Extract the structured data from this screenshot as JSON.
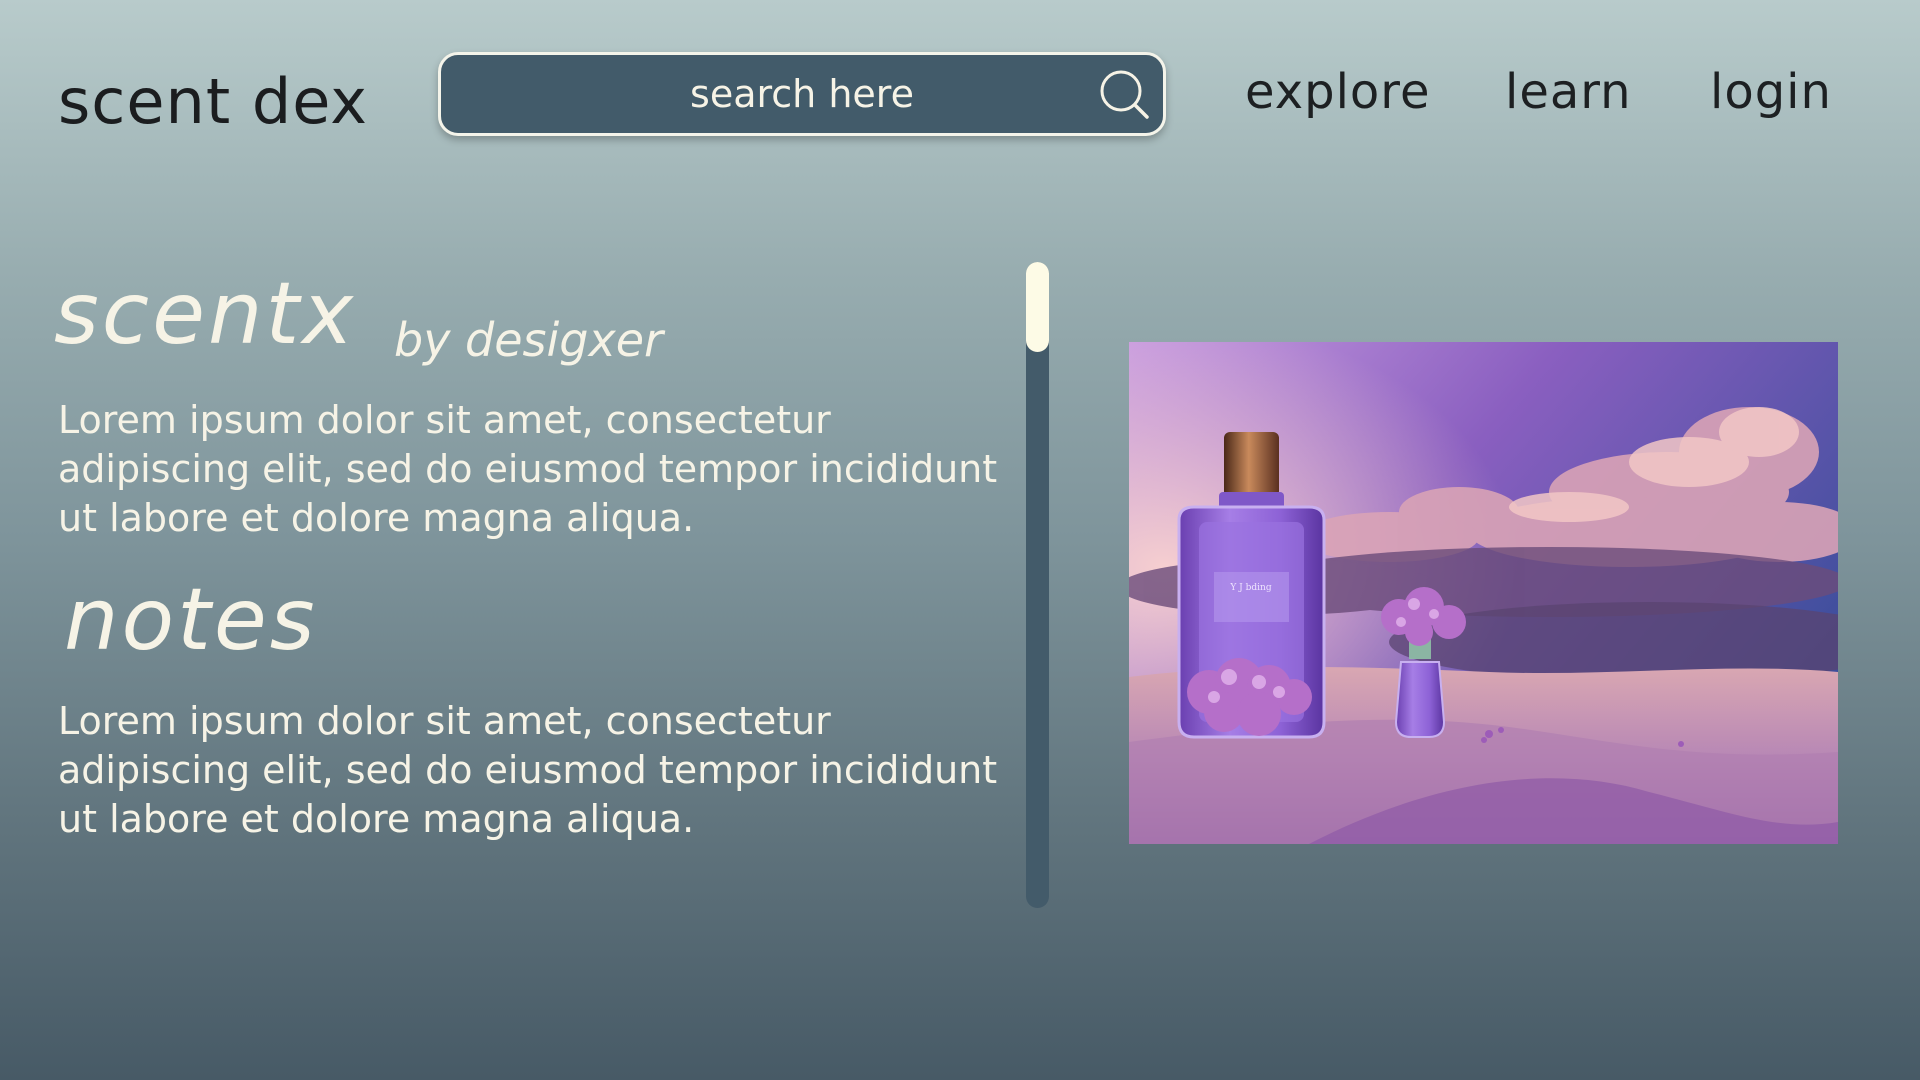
{
  "header": {
    "logo": "scent dex",
    "search": {
      "placeholder": "search here",
      "value": "",
      "icon": "search-icon"
    },
    "nav": {
      "explore": "explore",
      "learn": "learn",
      "login": "login"
    }
  },
  "product": {
    "name": "scentx",
    "brand": "by desigxer",
    "description": "Lorem ipsum dolor sit amet, consectetur adipiscing elit, sed do eiusmod tempor incididunt ut labore et dolore magna aliqua.",
    "notes_heading": "notes",
    "notes_text": "Lorem ipsum dolor sit amet, consectetur adipiscing elit, sed do eiusmod tempor incididunt ut labore et dolore magna aliqua.",
    "bottle_label": "Y J bding"
  },
  "colors": {
    "search_bg": "#425b6a",
    "text_light": "#f6f3e6",
    "text_dark": "#1b1d1f",
    "scroll_thumb": "#fdfbe6",
    "scroll_track": "#435b6a"
  },
  "image": {
    "subject": "purple perfume bottle with lavender flowers in desert dunes under a purple sky"
  }
}
